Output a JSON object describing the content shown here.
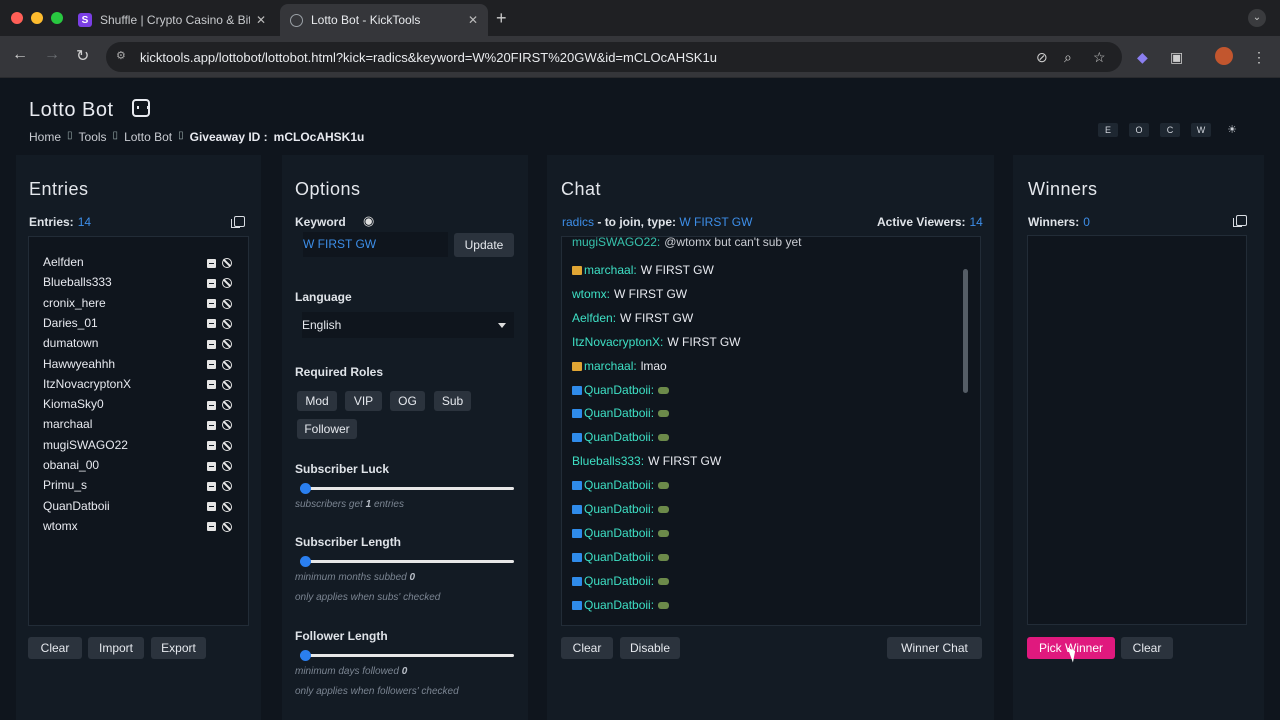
{
  "browser": {
    "tabs": [
      {
        "title": "Shuffle | Crypto Casino & Bitcoin",
        "favicon": "S",
        "favicon_color": "#7b3fe4"
      },
      {
        "title": "Lotto Bot - KickTools",
        "favicon": "globe-icon",
        "favicon_color": "#9aa0a6"
      }
    ],
    "new_tab": "+",
    "url": "kicktools.app/lottobot/lottobot.html?kick=radics&keyword=W%20FIRST%20GW&id=mCLOcAHSK1u"
  },
  "header": {
    "title": "Lotto Bot",
    "breadcrumb": {
      "home": "Home",
      "tools": "Tools",
      "lotto": "Lotto Bot",
      "giveaway_label": "Giveaway ID :",
      "giveaway_id": "mCLOcAHSK1u"
    },
    "theme_buttons": [
      "E",
      "O",
      "C",
      "W",
      "☀"
    ]
  },
  "entries": {
    "title": "Entries",
    "count_label": "Entries:",
    "count": "14",
    "names": [
      "Aelfden",
      "Blueballs333",
      "cronix_here",
      "Daries_01",
      "dumatown",
      "Hawwyeahhh",
      "ItzNovacryptonX",
      "KiomaSky0",
      "marchaal",
      "mugiSWAGO22",
      "obanai_00",
      "Primu_s",
      "QuanDatboii",
      "wtomx"
    ],
    "buttons": {
      "clear": "Clear",
      "import": "Import",
      "export": "Export"
    }
  },
  "options": {
    "title": "Options",
    "keyword_label": "Keyword",
    "keyword_value": "W FIRST GW",
    "update": "Update",
    "language_label": "Language",
    "language_value": "English",
    "roles_label": "Required Roles",
    "roles": [
      "Mod",
      "VIP",
      "OG",
      "Sub",
      "Follower"
    ],
    "sub_luck": {
      "label": "Subscriber Luck",
      "hint_pre": "subscribers get",
      "value": "1",
      "hint_post": "entries",
      "slider_level": 0
    },
    "sub_length": {
      "label": "Subscriber Length",
      "hint_pre": "minimum months subbed",
      "value": "0",
      "note": "only applies when subs' checked",
      "slider_level": 0
    },
    "follower_length": {
      "label": "Follower Length",
      "hint_pre": "minimum days followed",
      "value": "0",
      "note": "only applies when followers' checked",
      "slider_level": 0
    }
  },
  "chat": {
    "title": "Chat",
    "channel": "radics",
    "join_text": "- to join, type:",
    "keyword": "W FIRST GW",
    "viewers_label": "Active Viewers:",
    "viewers": "14",
    "messages": [
      {
        "badge": "",
        "user": "mugiSWAGO22:",
        "text": "@wtomx but can't sub yet",
        "emote": false
      },
      {
        "badge": "og",
        "user": "marchaal:",
        "text": "W FIRST GW",
        "emote": false
      },
      {
        "badge": "",
        "user": "wtomx:",
        "text": "W FIRST GW",
        "emote": false
      },
      {
        "badge": "",
        "user": "Aelfden:",
        "text": "W FIRST GW",
        "emote": false
      },
      {
        "badge": "",
        "user": "ItzNovacryptonX:",
        "text": "W FIRST GW",
        "emote": false
      },
      {
        "badge": "og",
        "user": "marchaal:",
        "text": "lmao",
        "emote": false
      },
      {
        "badge": "blue",
        "user": "QuanDatboii:",
        "text": "",
        "emote": true
      },
      {
        "badge": "blue",
        "user": "QuanDatboii:",
        "text": "",
        "emote": true
      },
      {
        "badge": "blue",
        "user": "QuanDatboii:",
        "text": "",
        "emote": true
      },
      {
        "badge": "",
        "user": "Blueballs333:",
        "text": "W FIRST GW",
        "emote": false
      },
      {
        "badge": "blue",
        "user": "QuanDatboii:",
        "text": "",
        "emote": true
      },
      {
        "badge": "blue",
        "user": "QuanDatboii:",
        "text": "",
        "emote": true
      },
      {
        "badge": "blue",
        "user": "QuanDatboii:",
        "text": "",
        "emote": true
      },
      {
        "badge": "blue",
        "user": "QuanDatboii:",
        "text": "",
        "emote": true
      },
      {
        "badge": "blue",
        "user": "QuanDatboii:",
        "text": "",
        "emote": true
      },
      {
        "badge": "blue",
        "user": "QuanDatboii:",
        "text": "",
        "emote": true
      }
    ],
    "buttons": {
      "clear": "Clear",
      "disable": "Disable",
      "winner_chat": "Winner Chat"
    }
  },
  "winners": {
    "title": "Winners",
    "count_label": "Winners:",
    "count": "0",
    "buttons": {
      "pick": "Pick Winner",
      "clear": "Clear"
    }
  }
}
